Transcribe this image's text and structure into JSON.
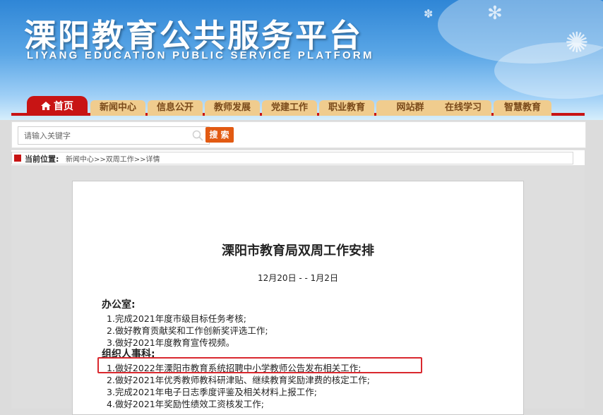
{
  "header": {
    "title": "溧阳教育公共服务平台",
    "subtitle": "LIYANG EDUCATION PUBLIC SERVICE PLATFORM"
  },
  "nav": {
    "items": [
      {
        "label": "首页",
        "icon": "home-icon",
        "active": true
      },
      {
        "label": "新闻中心"
      },
      {
        "label": "信息公开"
      },
      {
        "label": "教师发展"
      },
      {
        "label": "党建工作"
      },
      {
        "label": "职业教育"
      },
      {
        "label": "网站群"
      },
      {
        "label": "在线学习"
      },
      {
        "label": "智慧教育"
      }
    ]
  },
  "search": {
    "placeholder": "请输入关键字",
    "button": "搜索",
    "icon": "search-icon"
  },
  "breadcrumb": {
    "label": "当前位置:",
    "path": "新闻中心>>双周工作>>详情"
  },
  "article": {
    "title": "溧阳市教育局双周工作安排",
    "date": "12月20日 -  - 1月2日",
    "sections": [
      {
        "heading": "办公室:",
        "items": [
          "1.完成2021年度市级目标任务考核;",
          "2.做好教育贡献奖和工作创新奖评选工作;",
          "3.做好2021年度教育宣传视频。"
        ]
      },
      {
        "heading": "组织人事科:",
        "items": [
          "1.做好2022年溧阳市教育系统招聘中小学教师公告发布相关工作;",
          "2.做好2021年优秀教师教科研津贴、继续教育奖励津费的核定工作;",
          "3.完成2021年电子日志季度评鉴及相关材料上报工作;",
          "4.做好2021年奖励性绩效工资核发工作;"
        ]
      }
    ]
  },
  "colors": {
    "accent_red": "#c81414",
    "nav_tab": "#f0cc8e",
    "search_button": "#e25a12",
    "highlight_box": "#d9282e"
  }
}
